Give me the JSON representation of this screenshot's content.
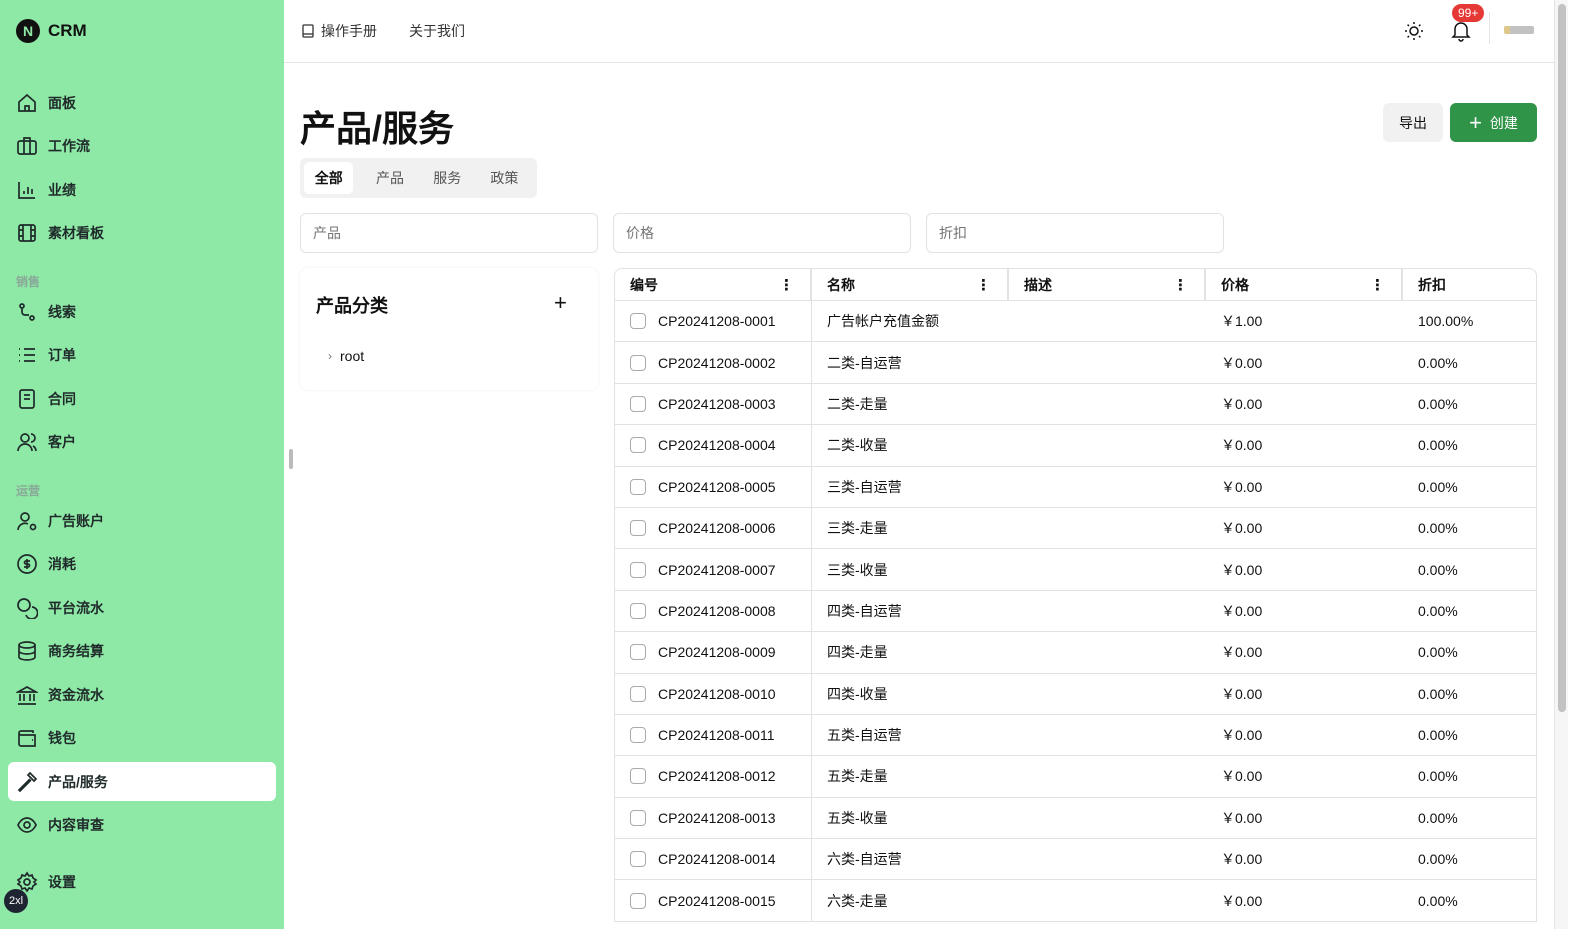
{
  "app": {
    "name": "CRM",
    "logo_letter": "N",
    "breakpoint": "2xl"
  },
  "sidebar": {
    "items_top": [
      {
        "label": "面板",
        "icon": "home-icon"
      },
      {
        "label": "工作流",
        "icon": "briefcase-icon"
      },
      {
        "label": "业绩",
        "icon": "bar-chart-icon"
      },
      {
        "label": "素材看板",
        "icon": "film-icon"
      }
    ],
    "section_sales": "销售",
    "items_sales": [
      {
        "label": "线索",
        "icon": "route-icon"
      },
      {
        "label": "订单",
        "icon": "list-icon"
      },
      {
        "label": "合同",
        "icon": "document-icon"
      },
      {
        "label": "客户",
        "icon": "users-icon"
      }
    ],
    "section_ops": "运营",
    "items_ops": [
      {
        "label": "广告账户",
        "icon": "user-cog-icon"
      },
      {
        "label": "消耗",
        "icon": "dollar-icon"
      },
      {
        "label": "平台流水",
        "icon": "coins-icon"
      },
      {
        "label": "商务结算",
        "icon": "database-icon"
      },
      {
        "label": "资金流水",
        "icon": "bank-icon"
      },
      {
        "label": "钱包",
        "icon": "wallet-icon"
      },
      {
        "label": "产品/服务",
        "icon": "hammer-icon",
        "active": true
      },
      {
        "label": "内容审查",
        "icon": "eye-icon"
      }
    ],
    "settings": {
      "label": "设置",
      "icon": "gear-icon"
    }
  },
  "topbar": {
    "manual": "操作手册",
    "about": "关于我们",
    "notifications": "99+"
  },
  "page": {
    "title": "产品/服务",
    "export": "导出",
    "create": "创建"
  },
  "tabs": [
    {
      "label": "全部",
      "active": true
    },
    {
      "label": "产品"
    },
    {
      "label": "服务"
    },
    {
      "label": "政策"
    }
  ],
  "filters": {
    "product": "产品",
    "price": "价格",
    "discount": "折扣"
  },
  "category": {
    "title": "产品分类",
    "root": "root"
  },
  "table": {
    "headers": [
      "编号",
      "名称",
      "描述",
      "价格",
      "折扣"
    ],
    "rows": [
      [
        "CP20241208-0001",
        "广告帐户充值金额",
        "",
        "￥1.00",
        "100.00%"
      ],
      [
        "CP20241208-0002",
        "二类-自运营",
        "",
        "￥0.00",
        "0.00%"
      ],
      [
        "CP20241208-0003",
        "二类-走量",
        "",
        "￥0.00",
        "0.00%"
      ],
      [
        "CP20241208-0004",
        "二类-收量",
        "",
        "￥0.00",
        "0.00%"
      ],
      [
        "CP20241208-0005",
        "三类-自运营",
        "",
        "￥0.00",
        "0.00%"
      ],
      [
        "CP20241208-0006",
        "三类-走量",
        "",
        "￥0.00",
        "0.00%"
      ],
      [
        "CP20241208-0007",
        "三类-收量",
        "",
        "￥0.00",
        "0.00%"
      ],
      [
        "CP20241208-0008",
        "四类-自运营",
        "",
        "￥0.00",
        "0.00%"
      ],
      [
        "CP20241208-0009",
        "四类-走量",
        "",
        "￥0.00",
        "0.00%"
      ],
      [
        "CP20241208-0010",
        "四类-收量",
        "",
        "￥0.00",
        "0.00%"
      ],
      [
        "CP20241208-0011",
        "五类-自运营",
        "",
        "￥0.00",
        "0.00%"
      ],
      [
        "CP20241208-0012",
        "五类-走量",
        "",
        "￥0.00",
        "0.00%"
      ],
      [
        "CP20241208-0013",
        "五类-收量",
        "",
        "￥0.00",
        "0.00%"
      ],
      [
        "CP20241208-0014",
        "六类-自运营",
        "",
        "￥0.00",
        "0.00%"
      ],
      [
        "CP20241208-0015",
        "六类-走量",
        "",
        "￥0.00",
        "0.00%"
      ]
    ]
  },
  "colors": {
    "sidebar": "#8ee8a6",
    "primary": "#2f9447",
    "badge": "#e53935"
  }
}
